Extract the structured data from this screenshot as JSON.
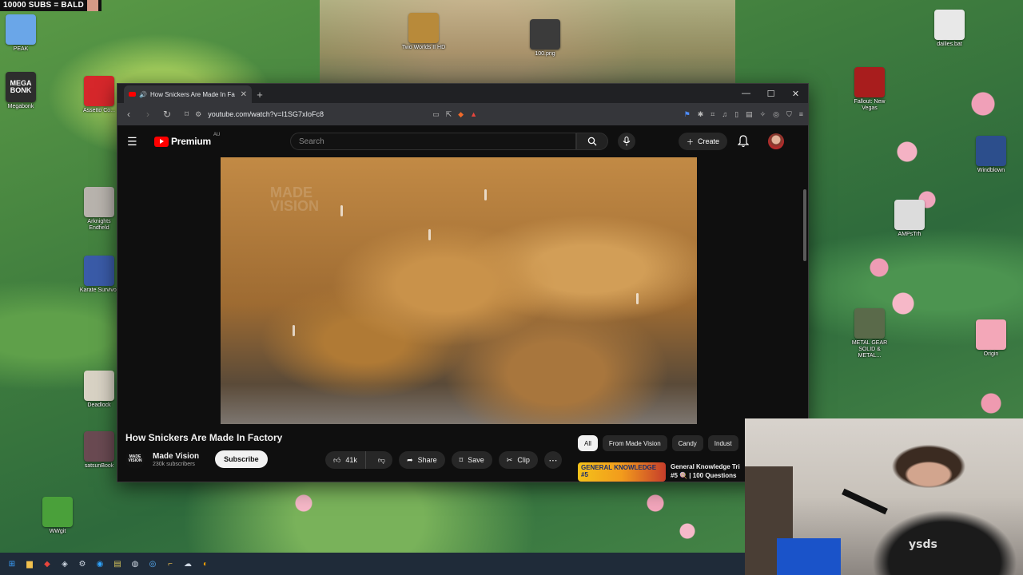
{
  "overlay": {
    "banner_text": "10000 SUBS = BALD"
  },
  "desktop_icons": [
    {
      "id": "peak",
      "label": "PEAK",
      "art": "",
      "color": "#6aa6e8"
    },
    {
      "id": "megabonk",
      "label": "Megabonk",
      "art": "MEGA BONK",
      "color": "#2d2d2d"
    },
    {
      "id": "assetto",
      "label": "Assetto Co...",
      "art": "",
      "color": "#d6272b"
    },
    {
      "id": "arknights",
      "label": "Arknights Endfield",
      "art": "",
      "color": "#b8b3ad"
    },
    {
      "id": "karate",
      "label": "Karate Survivor",
      "art": "",
      "color": "#3a5ba8"
    },
    {
      "id": "deadlock",
      "label": "Deadlock",
      "art": "",
      "color": "#d8d2c4"
    },
    {
      "id": "satsun",
      "label": "satsunBook",
      "art": "",
      "color": "#6a4a52"
    },
    {
      "id": "wwgit",
      "label": "WWgit",
      "art": "",
      "color": "#4aa03a"
    },
    {
      "id": "twoworlds",
      "label": "Two Worlds II HD",
      "art": "",
      "color": "#b88a3a"
    },
    {
      "id": "png100",
      "label": "100.png",
      "art": "",
      "color": "#3b3b3b"
    },
    {
      "id": "dailies",
      "label": "dailies.bat",
      "art": "",
      "color": "#e8e8e8"
    },
    {
      "id": "fallout",
      "label": "Fallout: New Vegas",
      "art": "",
      "color": "#a81d1d"
    },
    {
      "id": "windblown",
      "label": "Windblown",
      "art": "",
      "color": "#2c4e8c"
    },
    {
      "id": "amps",
      "label": "AMPsTrh",
      "art": "",
      "color": "#dcdcdc"
    },
    {
      "id": "metalgear",
      "label": "METAL GEAR SOLID & METAL...",
      "art": "",
      "color": "#5a6a4a"
    },
    {
      "id": "origin",
      "label": "Origin",
      "art": "",
      "color": "#f3a7b8"
    }
  ],
  "browser": {
    "tab_title": "How Snickers Are Made In Fa",
    "url": "youtube.com/watch?v=I1SG7xIoFc8",
    "window_controls": [
      "—",
      "☐",
      "✕"
    ]
  },
  "youtube": {
    "logo_text": "Premium",
    "logo_region": "AU",
    "search_placeholder": "Search",
    "create_label": "Create",
    "video": {
      "watermark": "MADE\nVISION",
      "title": "How Snickers Are Made In Factory",
      "channel_name": "Made Vision",
      "channel_avatar_text": "MADE VISION",
      "subscribers": "230k subscribers",
      "subscribe_label": "Subscribe",
      "likes": "41k",
      "share_label": "Share",
      "save_label": "Save",
      "clip_label": "Clip",
      "more_label": "⋯"
    },
    "chips": [
      "All",
      "From Made Vision",
      "Candy",
      "Indust"
    ],
    "recommendation": {
      "thumb_text": "GENERAL KNOWLEDGE #5",
      "title_line1": "General Knowledge Tri",
      "title_line2": "#5 🍭 | 100 Questions"
    }
  },
  "webcam": {
    "shirt_text": "ysds"
  }
}
